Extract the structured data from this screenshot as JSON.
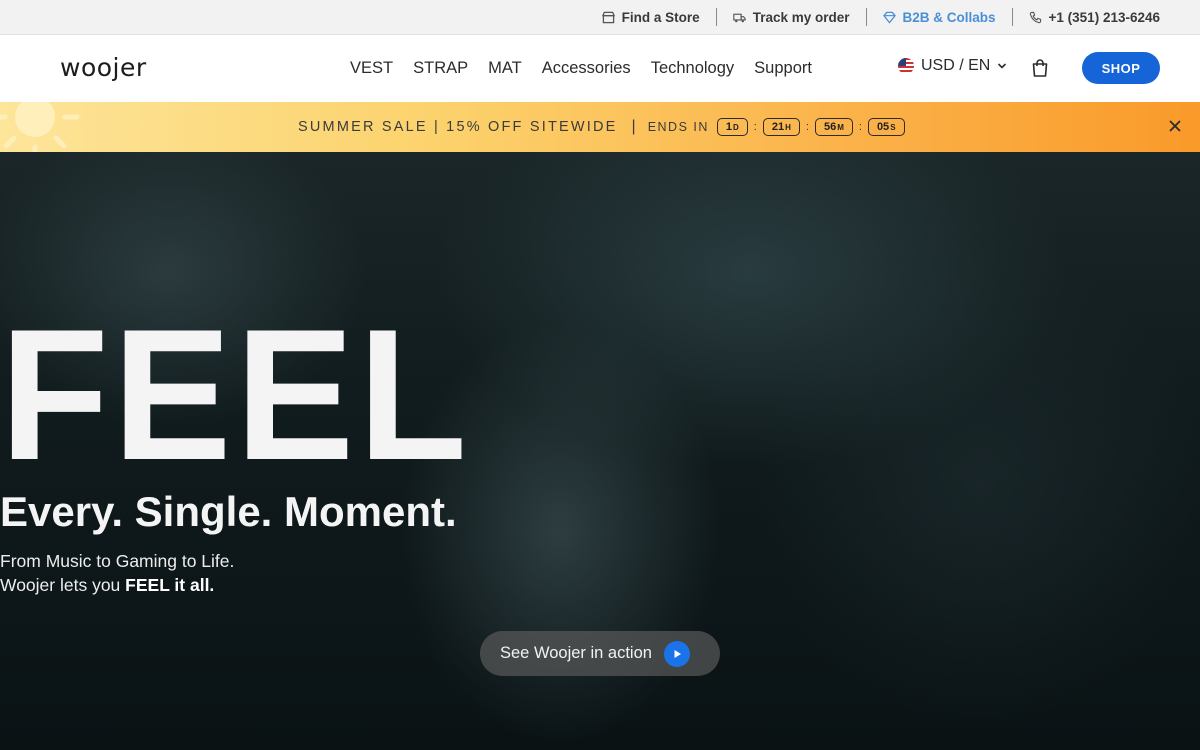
{
  "utility_bar": {
    "find_store": "Find a Store",
    "track_order": "Track my order",
    "b2b": "B2B & Collabs",
    "phone": "+1 (351) 213-6246"
  },
  "nav": {
    "logo": "woojer",
    "menu": [
      "VEST",
      "STRAP",
      "MAT",
      "Accessories",
      "Technology",
      "Support"
    ],
    "locale": "USD / EN",
    "shop_label": "SHOP"
  },
  "promo": {
    "text": "SUMMER SALE | 15% OFF SITEWIDE",
    "divider": "|",
    "ends_label": "ENDS IN",
    "countdown": [
      {
        "value": "1",
        "unit": "D"
      },
      {
        "value": "21",
        "unit": "H"
      },
      {
        "value": "56",
        "unit": "M"
      },
      {
        "value": "05",
        "unit": "S"
      }
    ]
  },
  "hero": {
    "headline": "FEEL",
    "tagline": "Every. Single. Moment.",
    "line1": "From Music to Gaming to Life.",
    "line2_prefix": "Woojer lets you ",
    "line2_bold": "FEEL it all.",
    "cta_label": "See Woojer in action"
  },
  "colors": {
    "shop_button": "#1565d8",
    "b2b_link": "#4a8fd8",
    "play_button": "#1a73e8"
  }
}
